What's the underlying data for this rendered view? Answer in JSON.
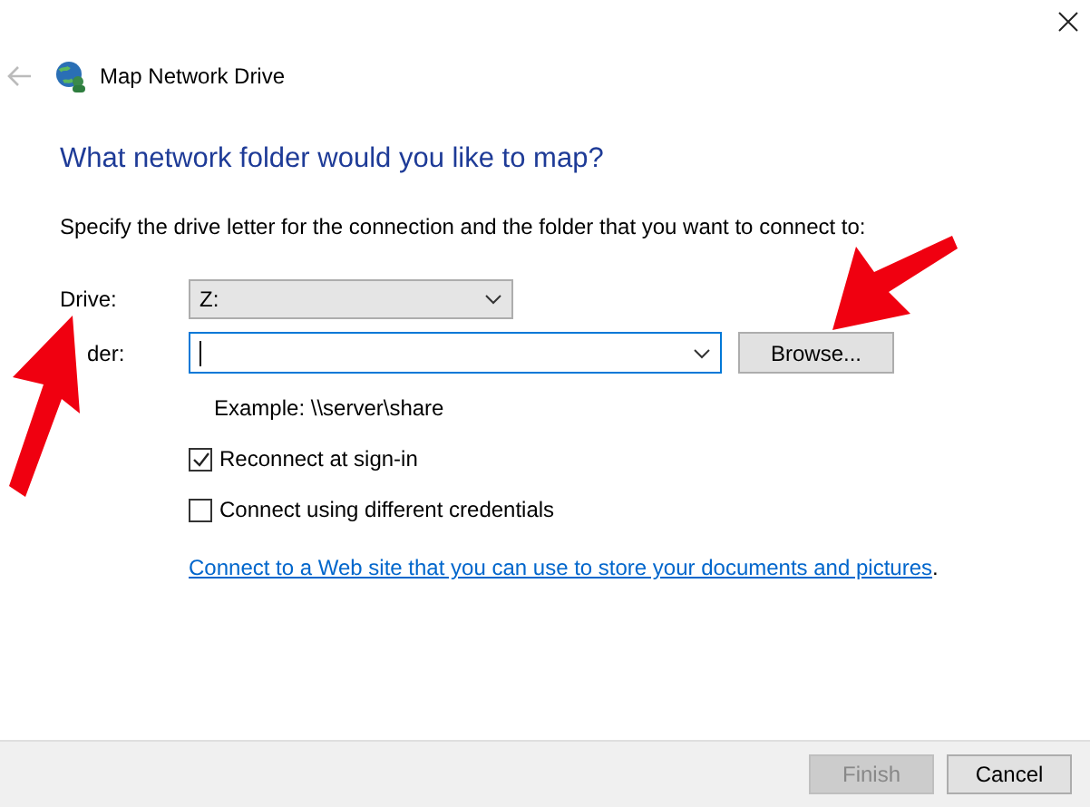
{
  "window": {
    "title": "Map Network Drive",
    "back_disabled": true
  },
  "heading": "What network folder would you like to map?",
  "instruction": "Specify the drive letter for the connection and the folder that you want to connect to:",
  "drive": {
    "label": "Drive:",
    "value": "Z:"
  },
  "folder": {
    "label": "der:",
    "focused": true
  },
  "browse_button": "Browse...",
  "example": "Example: \\\\server\\share",
  "options": [
    {
      "label": "Reconnect at sign-in",
      "checked": true
    },
    {
      "label": "Connect using different credentials",
      "checked": false
    }
  ],
  "link": {
    "text": "Connect to a Web site that you can use to store your documents and pictures",
    "suffix": "."
  },
  "buttons": [
    {
      "label": "Finish",
      "disabled": true
    },
    {
      "label": "Cancel",
      "disabled": false
    }
  ]
}
